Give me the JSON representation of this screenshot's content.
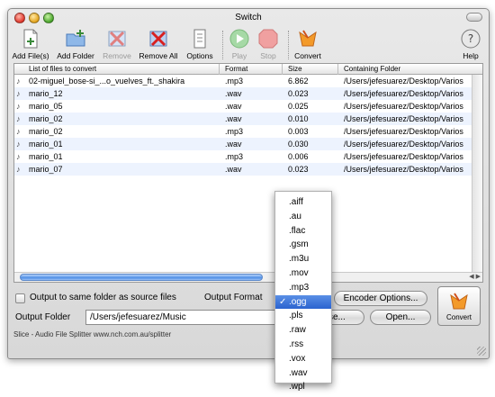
{
  "window": {
    "title": "Switch"
  },
  "toolbar": {
    "add_files": "Add File(s)",
    "add_folder": "Add Folder",
    "remove": "Remove",
    "remove_all": "Remove All",
    "options": "Options",
    "play": "Play",
    "stop": "Stop",
    "convert": "Convert",
    "help": "Help"
  },
  "list": {
    "columns": [
      "List of files to convert",
      "Format",
      "Size",
      "Containing Folder"
    ],
    "rows": [
      {
        "name": "02-miguel_bose-si_...o_vuelves_ft._shakira",
        "format": ".mp3",
        "size": "6.862",
        "folder": "/Users/jefesuarez/Desktop/Varios"
      },
      {
        "name": "mario_12",
        "format": ".wav",
        "size": "0.023",
        "folder": "/Users/jefesuarez/Desktop/Varios"
      },
      {
        "name": "mario_05",
        "format": ".wav",
        "size": "0.025",
        "folder": "/Users/jefesuarez/Desktop/Varios"
      },
      {
        "name": "mario_02",
        "format": ".wav",
        "size": "0.010",
        "folder": "/Users/jefesuarez/Desktop/Varios"
      },
      {
        "name": "mario_02",
        "format": ".mp3",
        "size": "0.003",
        "folder": "/Users/jefesuarez/Desktop/Varios"
      },
      {
        "name": "mario_01",
        "format": ".wav",
        "size": "0.030",
        "folder": "/Users/jefesuarez/Desktop/Varios"
      },
      {
        "name": "mario_01",
        "format": ".mp3",
        "size": "0.006",
        "folder": "/Users/jefesuarez/Desktop/Varios"
      },
      {
        "name": "mario_07",
        "format": ".wav",
        "size": "0.023",
        "folder": "/Users/jefesuarez/Desktop/Varios"
      }
    ]
  },
  "options": {
    "same_folder_label": "Output to same folder as source files",
    "output_format_label": "Output Format",
    "encoder_options": "Encoder Options...",
    "output_folder_label": "Output Folder",
    "output_folder_value": "/Users/jefesuarez/Music",
    "browse": "Browse...",
    "open": "Open...",
    "convert": "Convert"
  },
  "format_menu": {
    "items": [
      ".aiff",
      ".au",
      ".flac",
      ".gsm",
      ".m3u",
      ".mov",
      ".mp3",
      ".ogg",
      ".pls",
      ".raw",
      ".rss",
      ".vox",
      ".wav",
      ".wpl"
    ],
    "selected_index": 7,
    "check": "✓"
  },
  "status": {
    "text": "Slice - Audio File Splitter www.nch.com.au/splitter"
  },
  "colors": {
    "selection": "#2a63cf",
    "row_alt": "#edf3fe",
    "scroll_thumb": "#4f8ee5"
  }
}
